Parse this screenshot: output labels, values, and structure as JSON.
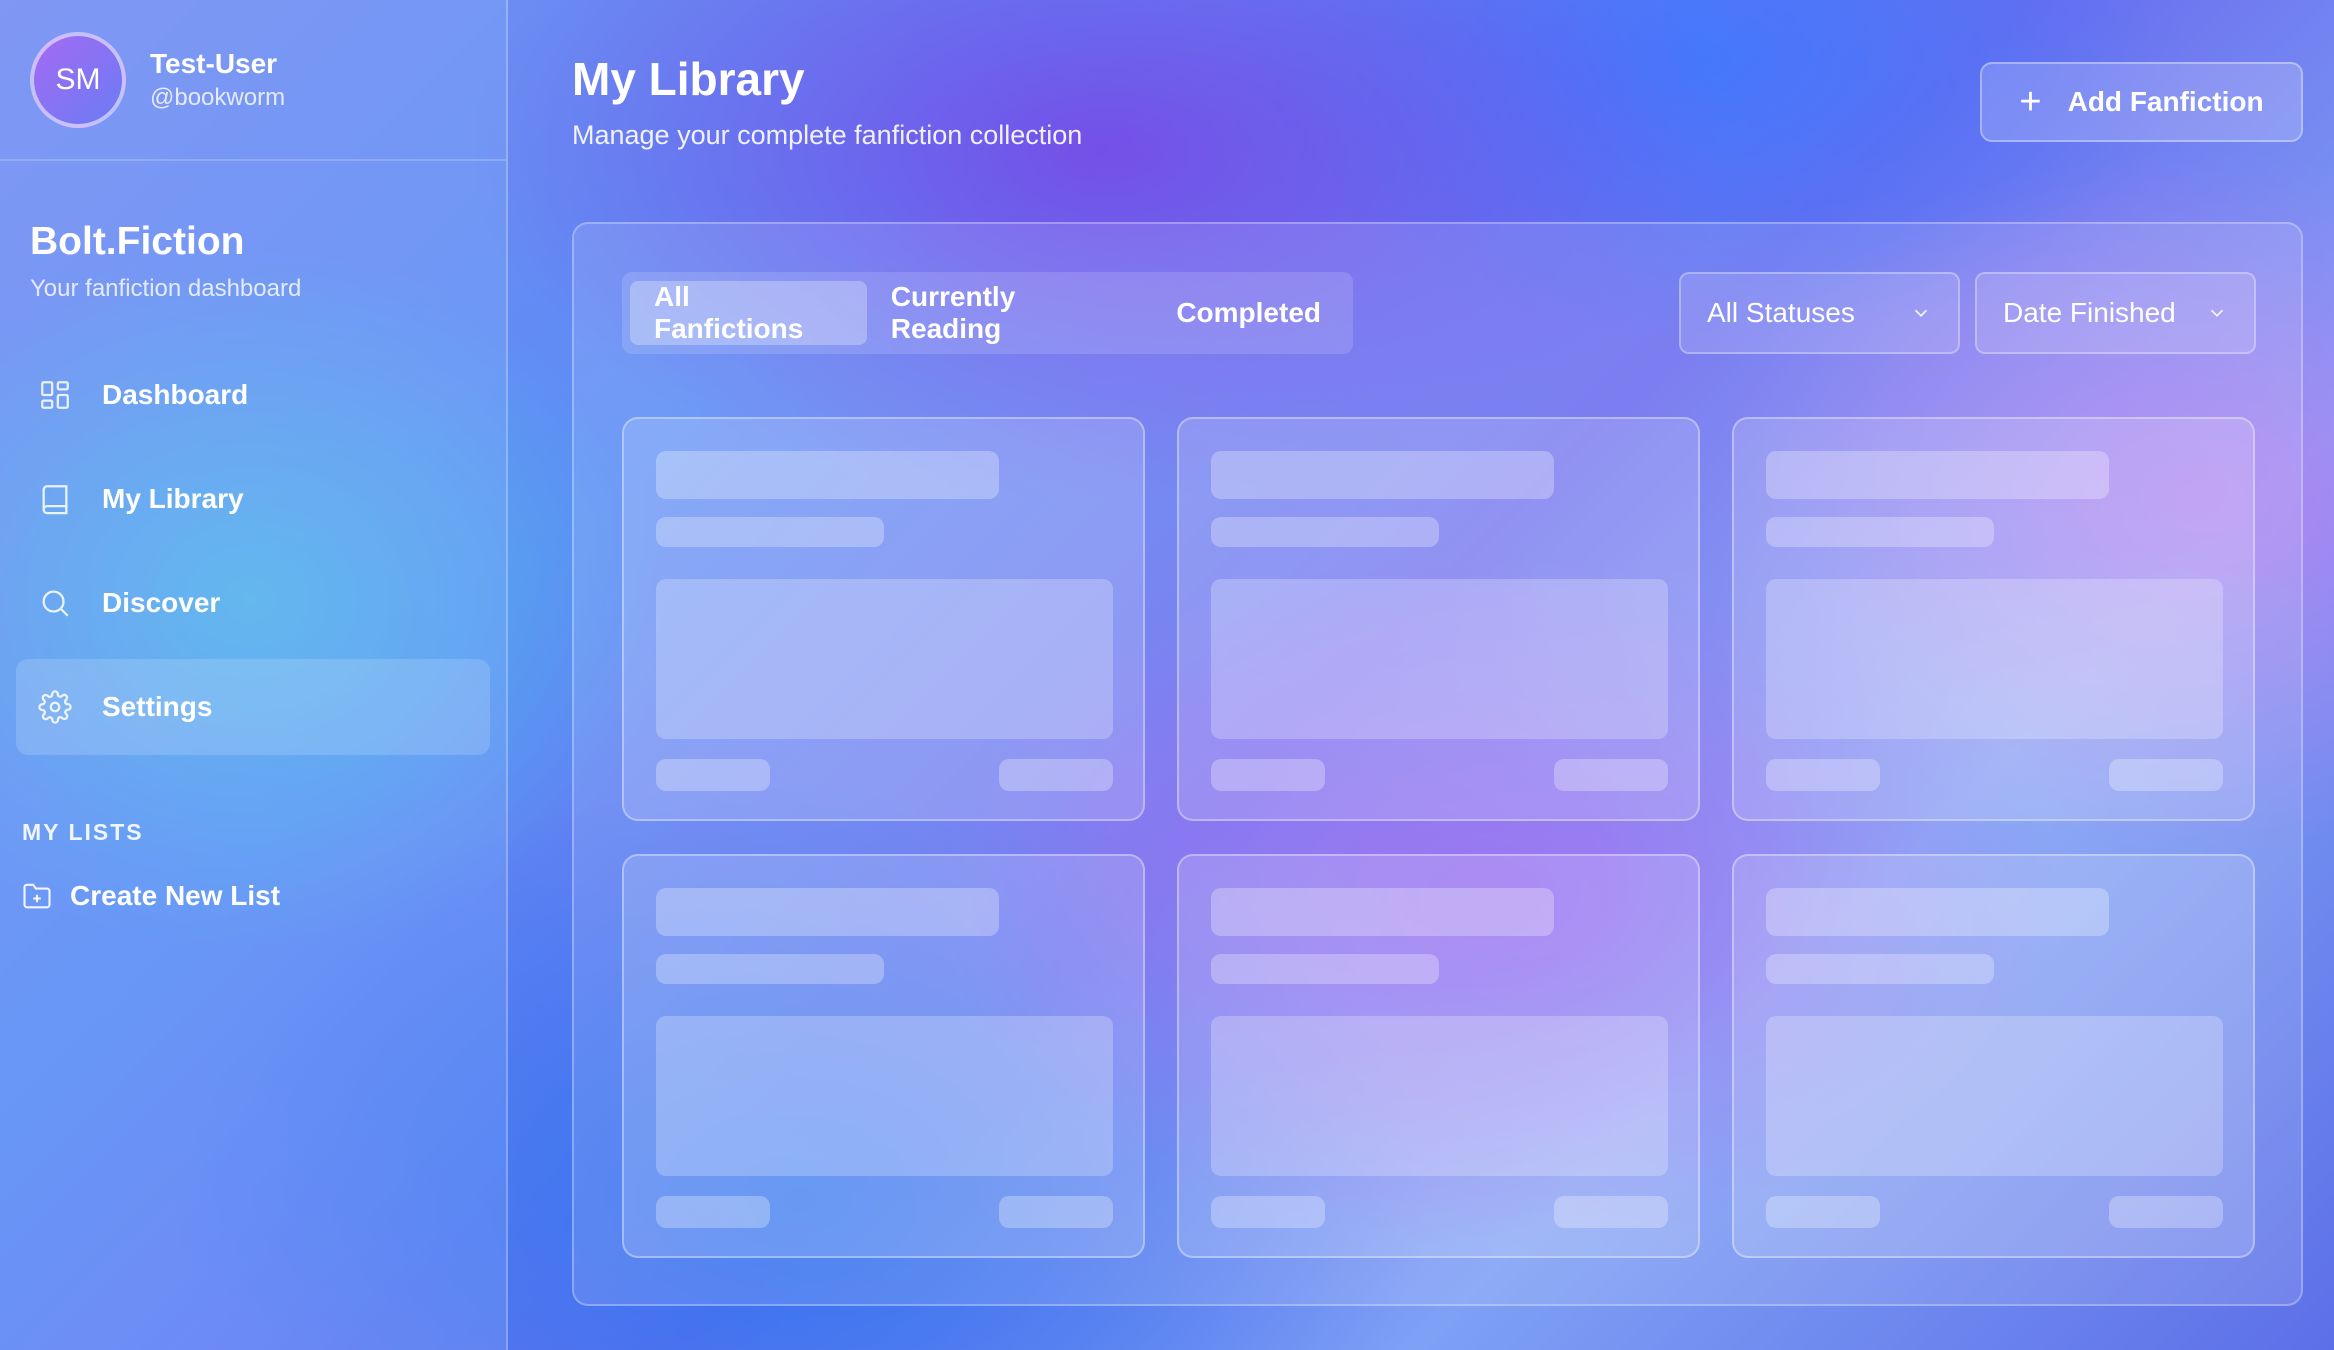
{
  "user": {
    "initials": "SM",
    "name": "Test-User",
    "handle": "@bookworm"
  },
  "brand": {
    "title": "Bolt.Fiction",
    "subtitle": "Your fanfiction dashboard"
  },
  "nav": [
    {
      "label": "Dashboard",
      "icon": "dashboard-icon"
    },
    {
      "label": "My Library",
      "icon": "book-icon"
    },
    {
      "label": "Discover",
      "icon": "search-icon"
    },
    {
      "label": "Settings",
      "icon": "gear-icon",
      "active": true
    }
  ],
  "lists": {
    "header": "MY LISTS",
    "create_label": "Create New List"
  },
  "page": {
    "title": "My Library",
    "subtitle": "Manage your complete fanfiction collection",
    "add_button": "Add Fanfiction"
  },
  "tabs": [
    {
      "label": "All Fanfictions",
      "active": true
    },
    {
      "label": "Currently Reading"
    },
    {
      "label": "Completed"
    }
  ],
  "filters": {
    "status": "All Statuses",
    "sort": "Date Finished"
  },
  "cards": {
    "count": 6,
    "state": "loading-skeleton"
  }
}
